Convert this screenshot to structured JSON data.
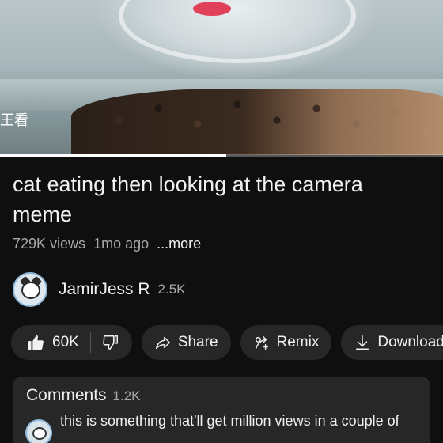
{
  "video": {
    "overlay_text": "王看",
    "progress_fraction": 0.51
  },
  "title": "cat eating then looking at the camera meme",
  "meta": {
    "views": "729K views",
    "age": "1mo ago",
    "more": "...more"
  },
  "channel": {
    "name": "JamirJess R",
    "subscribers": "2.5K"
  },
  "actions": {
    "likes": "60K",
    "share": "Share",
    "remix": "Remix",
    "download": "Download"
  },
  "comments": {
    "title": "Comments",
    "count": "1.2K",
    "top_comment": "this is something that'll get million views in a couple of"
  }
}
